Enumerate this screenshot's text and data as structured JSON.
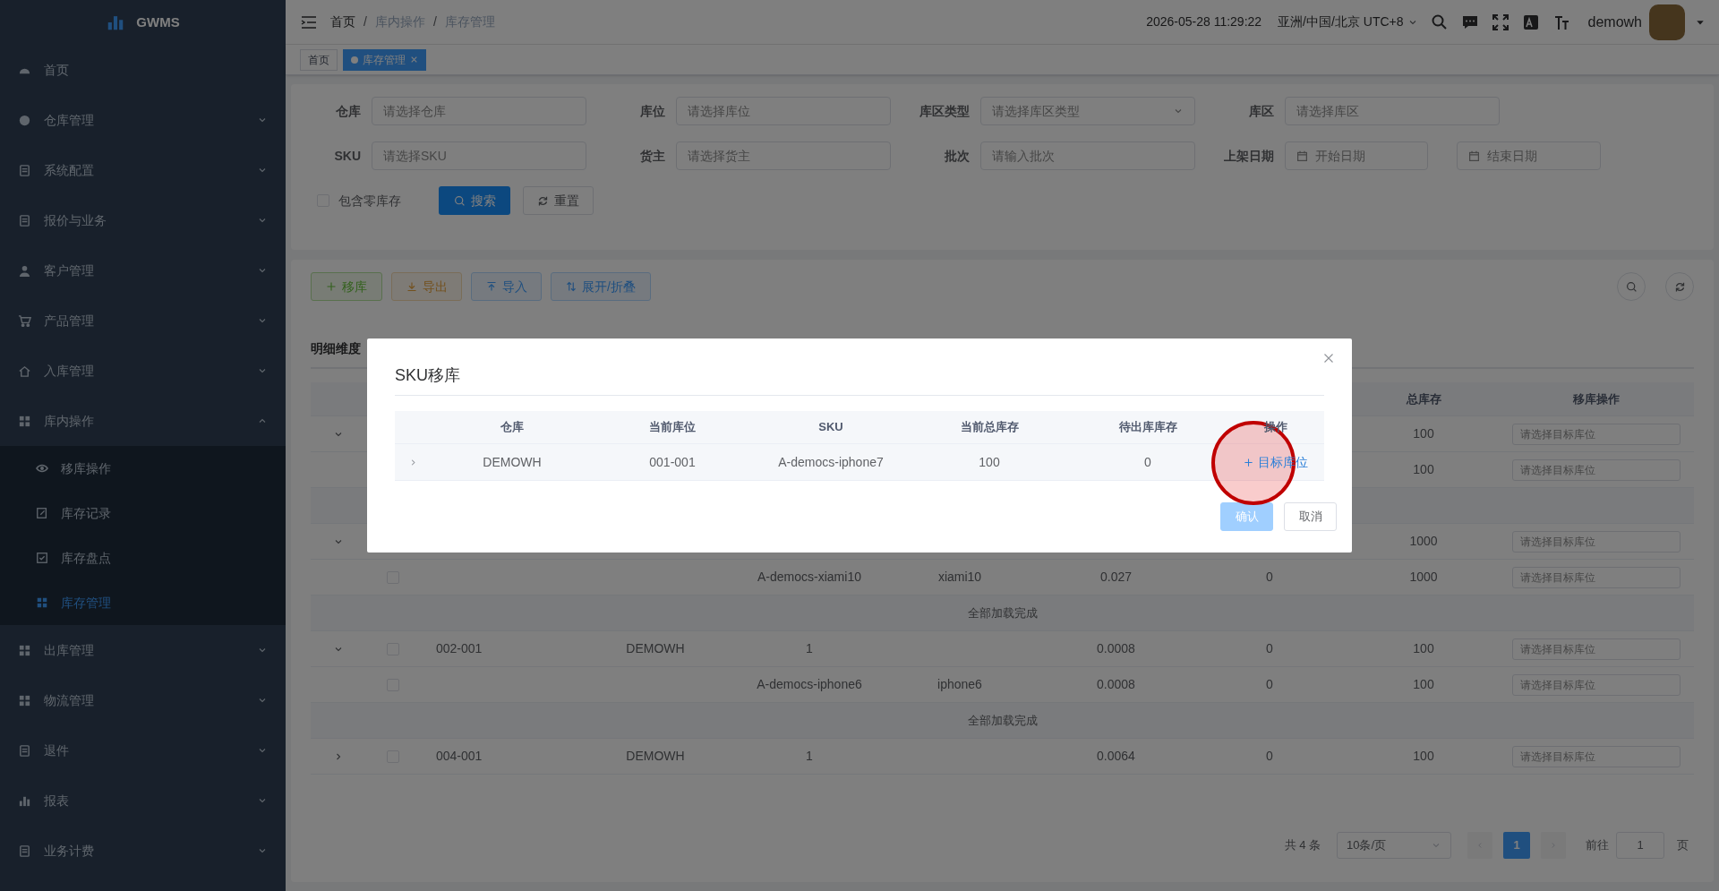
{
  "sidebar": {
    "logo": "GWMS",
    "items": [
      {
        "label": "首页",
        "kind": "link"
      },
      {
        "label": "仓库管理",
        "kind": "menu",
        "expanded": false
      },
      {
        "label": "系统配置",
        "kind": "menu",
        "expanded": false
      },
      {
        "label": "报价与业务",
        "kind": "menu",
        "expanded": false
      },
      {
        "label": "客户管理",
        "kind": "menu",
        "expanded": false
      },
      {
        "label": "产品管理",
        "kind": "menu",
        "expanded": false
      },
      {
        "label": "入库管理",
        "kind": "menu",
        "expanded": false
      },
      {
        "label": "库内操作",
        "kind": "menu",
        "expanded": true,
        "children": [
          {
            "label": "移库操作",
            "selected": false
          },
          {
            "label": "库存记录",
            "selected": false
          },
          {
            "label": "库存盘点",
            "selected": false
          },
          {
            "label": "库存管理",
            "selected": true
          }
        ]
      },
      {
        "label": "出库管理",
        "kind": "menu",
        "expanded": false
      },
      {
        "label": "物流管理",
        "kind": "menu",
        "expanded": false
      },
      {
        "label": "退件",
        "kind": "menu",
        "expanded": false
      },
      {
        "label": "报表",
        "kind": "menu",
        "expanded": false
      },
      {
        "label": "业务计费",
        "kind": "menu",
        "expanded": false
      }
    ]
  },
  "header": {
    "breadcrumb": [
      "首页",
      "库内操作",
      "库存管理"
    ],
    "breadcrumb_separators": [
      "/",
      "/"
    ],
    "datetime": "2026-05-28 11:29:22",
    "timezone": "亚洲/中国/北京 UTC+8",
    "user": "demowh"
  },
  "tags": [
    {
      "label": "首页",
      "selected": false
    },
    {
      "label": "库存管理",
      "selected": true
    }
  ],
  "filters": [
    [
      {
        "label": "仓库",
        "kind": "input",
        "placeholder": "请选择仓库"
      },
      {
        "label": "库位",
        "kind": "input",
        "placeholder": "请选择库位"
      },
      {
        "label": "库区类型",
        "kind": "select",
        "placeholder": "请选择库区类型"
      },
      {
        "label": "库区",
        "kind": "input",
        "placeholder": "请选择库区"
      }
    ],
    [
      {
        "label": "SKU",
        "kind": "input",
        "placeholder": "请选择SKU"
      },
      {
        "label": "货主",
        "kind": "input",
        "placeholder": "请选择货主"
      },
      {
        "label": "批次",
        "kind": "input",
        "placeholder": "请输入批次"
      },
      {
        "label": "上架日期",
        "kind": "daterange",
        "start_placeholder": "开始日期",
        "end_placeholder": "结束日期"
      }
    ]
  ],
  "include_zero": {
    "label": "包含零库存",
    "checked": false
  },
  "search_button": "搜索",
  "reset_button": "重置",
  "toolbar": [
    {
      "label": "移库",
      "kind": "move"
    },
    {
      "label": "导出",
      "kind": "export"
    },
    {
      "label": "导入",
      "kind": "import"
    },
    {
      "label": "展开/折叠",
      "kind": "toggle"
    }
  ],
  "table": {
    "tab": "明细维度",
    "column_9": "总库存",
    "column_10": "移库操作",
    "rows": [
      {
        "kind": "group",
        "expanded": true,
        "column_9": "100",
        "target_placeholder": "请选择目标库位"
      },
      {
        "kind": "item",
        "column_9": "100",
        "target_placeholder": "请选择目标库位"
      },
      {
        "kind": "loaded"
      },
      {
        "kind": "group",
        "expanded": true,
        "column_9": "1000",
        "target_placeholder": "请选择目标库位"
      },
      {
        "kind": "item",
        "checked": false,
        "column_5": "A-democs-xiami10",
        "column_6": "xiami10",
        "column_7": "0.027",
        "column_8": "0",
        "column_9": "1000",
        "target_placeholder": "请选择目标库位"
      },
      {
        "kind": "loaded",
        "text": "全部加载完成"
      },
      {
        "kind": "group",
        "expanded": true,
        "checked": false,
        "column_3": "002-001",
        "column_4": "DEMOWH",
        "column_5": "1",
        "column_7": "0.0008",
        "column_8": "0",
        "column_9": "100",
        "target_placeholder": "请选择目标库位"
      },
      {
        "kind": "item",
        "checked": false,
        "column_5": "A-democs-iphone6",
        "column_6": "iphone6",
        "column_7": "0.0008",
        "column_8": "0",
        "column_9": "100",
        "target_placeholder": "请选择目标库位"
      },
      {
        "kind": "loaded",
        "text": "全部加载完成"
      },
      {
        "kind": "group",
        "expanded": false,
        "checked": false,
        "column_3": "004-001",
        "column_4": "DEMOWH",
        "column_5": "1",
        "column_7": "0.0064",
        "column_8": "0",
        "column_9": "100",
        "target_placeholder": "请选择目标库位"
      }
    ]
  },
  "pagination": {
    "total": "共 4 条",
    "page_size": "10条/页",
    "pages": [
      {
        "label": "1",
        "selected": true
      }
    ],
    "goto_label": "前往",
    "goto_value": "1",
    "page_suffix": "页"
  },
  "modal": {
    "title": "SKU移库",
    "columns": [
      "仓库",
      "当前库位",
      "SKU",
      "当前总库存",
      "待出库库存",
      "操作"
    ],
    "rows": [
      {
        "expanded": false,
        "cells": [
          "DEMOWH",
          "001-001",
          "A-democs-iphone7",
          "100",
          "0"
        ],
        "action": "目标库位"
      }
    ],
    "buttons": [
      {
        "label": "确认",
        "kind": "primary",
        "disabled": true
      },
      {
        "label": "取消",
        "kind": "default",
        "disabled": false
      }
    ]
  }
}
